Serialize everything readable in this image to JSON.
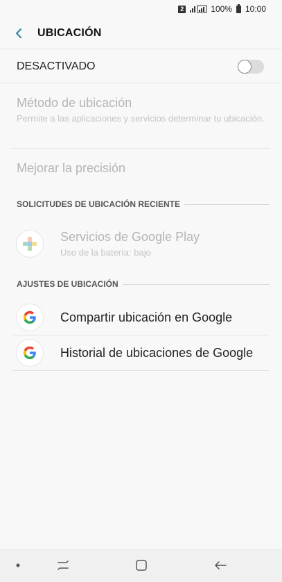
{
  "status_bar": {
    "sim": "2",
    "battery_percent": "100%",
    "time": "10:00"
  },
  "header": {
    "back_icon": "chevron-left-icon",
    "title": "UBICACIÓN"
  },
  "master_toggle": {
    "label": "DESACTIVADO",
    "state": "off"
  },
  "location_method": {
    "title": "Método de ubicación",
    "subtitle": "Permite a las aplicaciones y servicios determinar tu ubicación."
  },
  "improve_accuracy": {
    "title": "Mejorar la precisión"
  },
  "recent_requests": {
    "header": "SOLICITUDES DE UBICACIÓN RECIENTE",
    "items": [
      {
        "name": "Servicios de Google Play",
        "detail": "Uso de la batería: bajo",
        "icon": "google-play-services-icon"
      }
    ]
  },
  "location_settings": {
    "header": "AJUSTES DE UBICACIÓN",
    "items": [
      {
        "name": "Compartir ubicación en Google",
        "icon": "google-g-icon"
      },
      {
        "name": "Historial de ubicaciones de Google",
        "icon": "google-g-icon"
      }
    ]
  },
  "colors": {
    "accent": "#2d7fa6",
    "disabled_text": "#b5b5b5",
    "background": "#f8f8f8"
  }
}
